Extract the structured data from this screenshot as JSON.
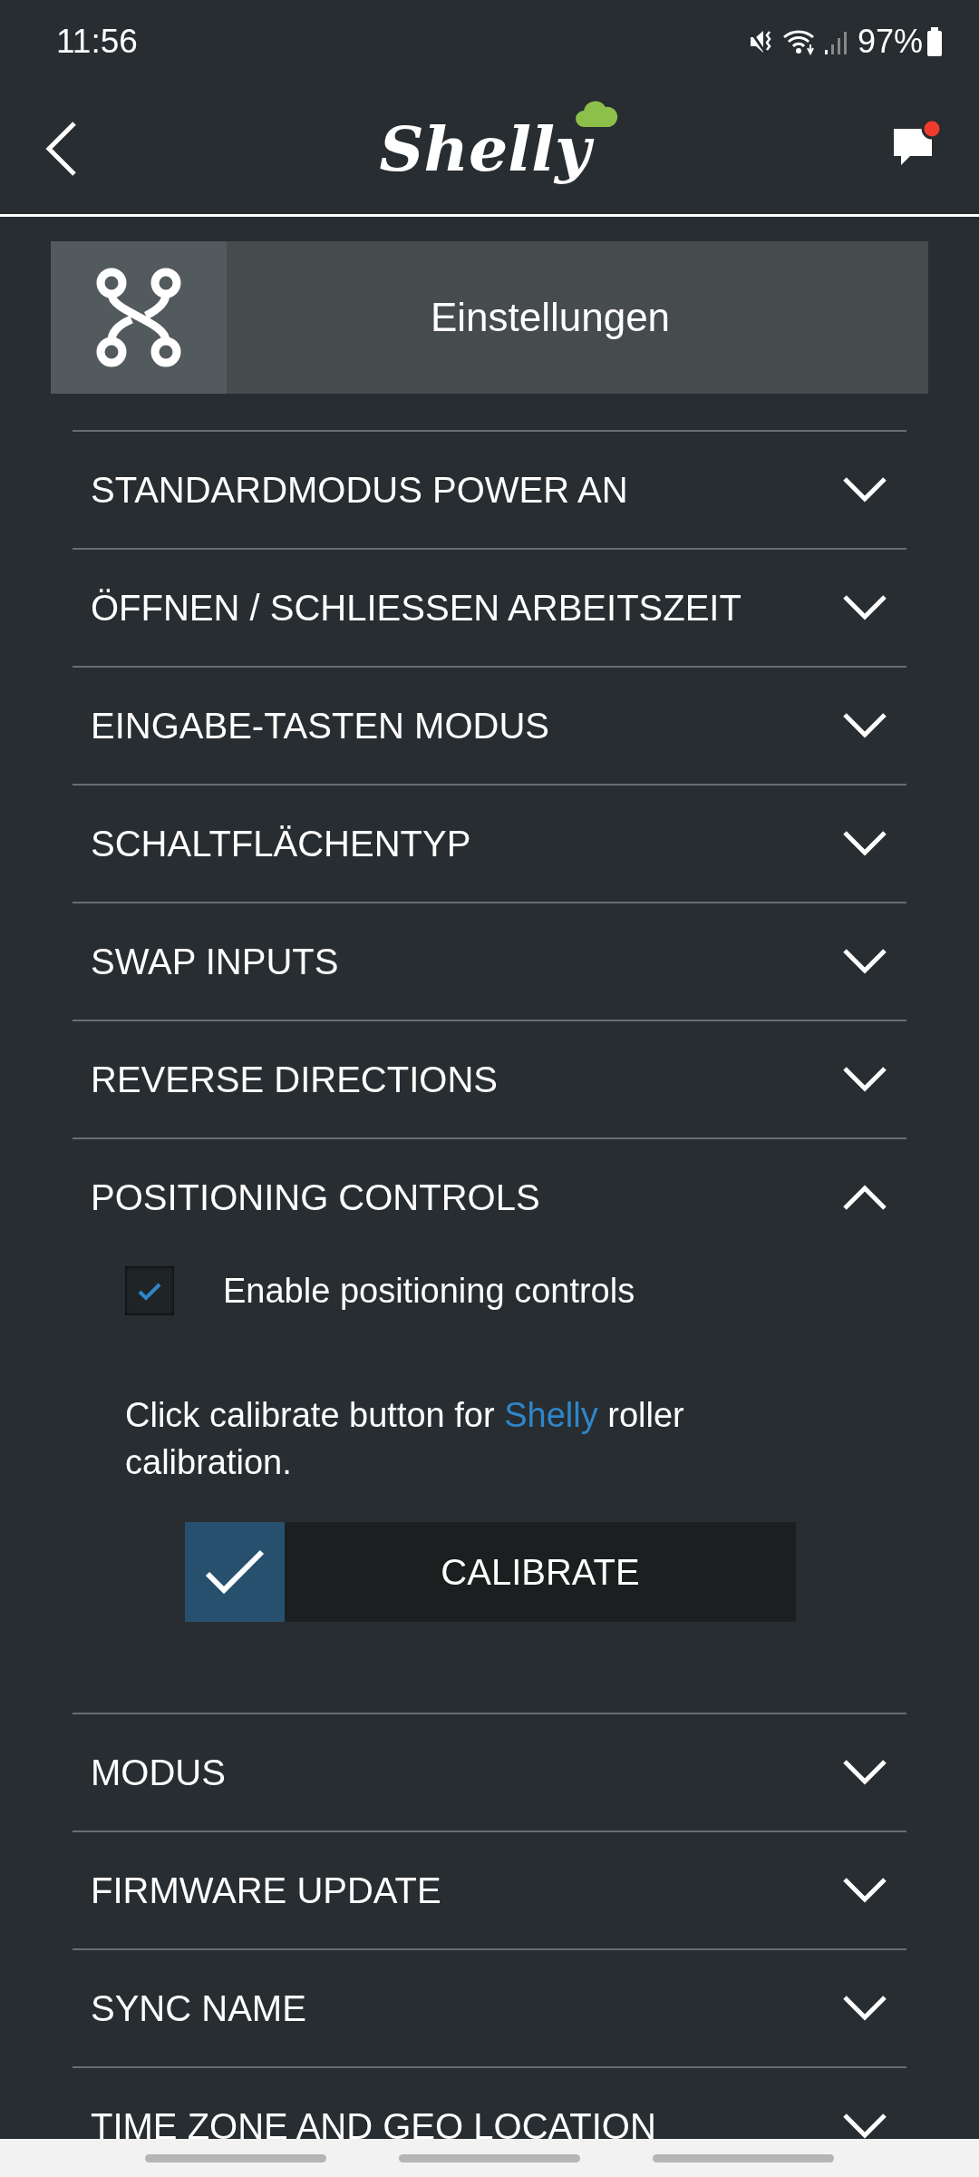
{
  "status_bar": {
    "time": "11:56",
    "battery": "97%"
  },
  "header": {
    "logo": "Shelly"
  },
  "banner": {
    "title": "Einstellungen"
  },
  "sections": [
    {
      "title": "STANDARDMODUS POWER AN",
      "expanded": false
    },
    {
      "title": "ÖFFNEN / SCHLIESSEN ARBEITSZEIT",
      "expanded": false
    },
    {
      "title": "EINGABE-TASTEN MODUS",
      "expanded": false
    },
    {
      "title": "SCHALTFLÄCHENTYP",
      "expanded": false
    },
    {
      "title": "SWAP INPUTS",
      "expanded": false
    },
    {
      "title": "REVERSE DIRECTIONS",
      "expanded": false
    },
    {
      "title": "POSITIONING CONTROLS",
      "expanded": true,
      "content": {
        "checkbox": {
          "label": "Enable positioning controls",
          "checked": true
        },
        "note": {
          "before": "Click calibrate button for",
          "link": "Shelly",
          "after": "roller calibration."
        },
        "button": "CALIBRATE"
      }
    },
    {
      "title": "MODUS",
      "expanded": false
    },
    {
      "title": "FIRMWARE UPDATE",
      "expanded": false
    },
    {
      "title": "SYNC NAME",
      "expanded": false
    },
    {
      "title": "TIME ZONE AND GEO LOCATION",
      "expanded": false
    }
  ]
}
